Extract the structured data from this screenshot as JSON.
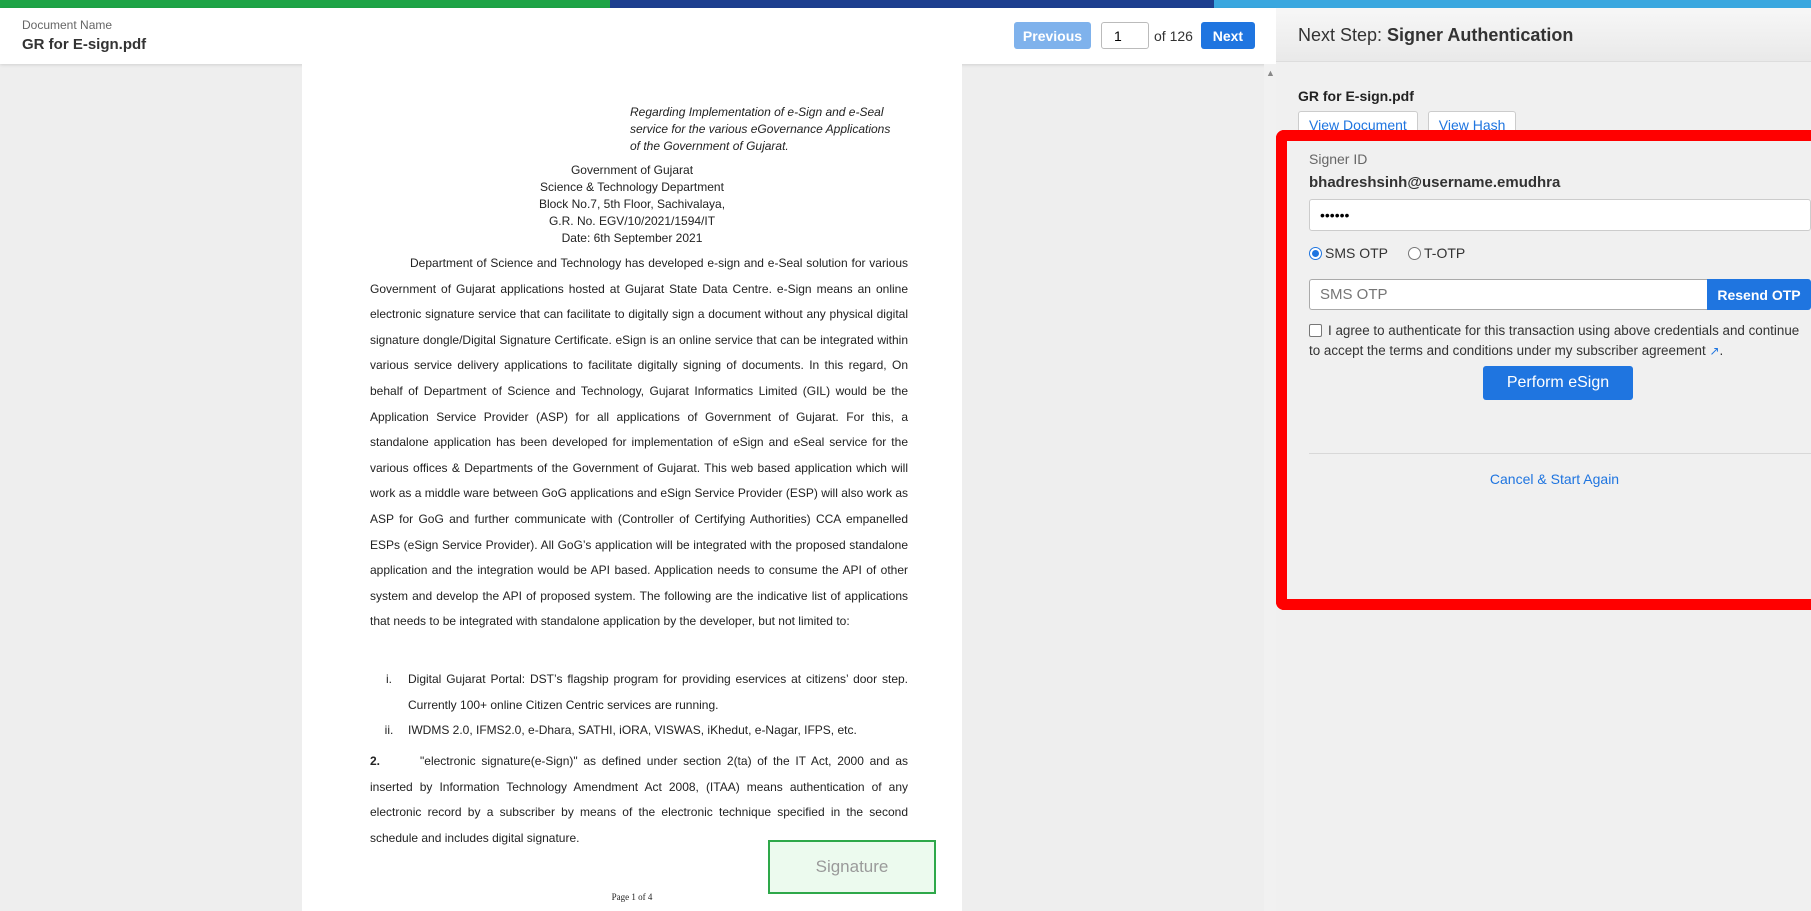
{
  "header": {
    "doc_name_label": "Document Name",
    "doc_name": "GR for E-sign.pdf",
    "previous_label": "Previous",
    "page_current": "1",
    "page_total": "of 126",
    "next_label": "Next"
  },
  "document": {
    "ref_lines": [
      "Regarding Implementation of e-Sign and e-Seal",
      "service for the various eGovernance Applications",
      "of the Government of Gujarat."
    ],
    "center_lines": [
      "Government of Gujarat",
      "Science & Technology Department",
      "Block No.7, 5th Floor, Sachivalaya,",
      "G.R. No. EGV/10/2021/1594/IT",
      "Date: 6th September 2021"
    ],
    "paragraph1": "Department of Science and Technology has developed e-sign and e-Seal solution for various Government of Gujarat applications hosted at Gujarat State Data Centre. e-Sign means an online electronic signature service that can facilitate to digitally sign a document without any physical digital signature dongle/Digital Signature Certificate. eSign is an online service that can be integrated within various service delivery applications to facilitate digitally signing of documents. In this regard, On behalf of Department of Science and Technology, Gujarat Informatics Limited (GIL) would be the Application Service Provider (ASP) for all applications of Government of Gujarat. For this, a standalone application has been developed for implementation of eSign and eSeal service for the various offices & Departments of the Government of Gujarat. This web based application which will work as a middle ware between GoG applications and eSign Service Provider (ESP) will also work as ASP for GoG and further communicate with (Controller of Certifying Authorities) CCA empanelled ESPs (eSign Service Provider). All GoG’s application will be integrated with the proposed standalone application and the integration would be API based. Application needs to consume the API of other system and develop the API of proposed system. The following are the indicative list of applications that needs to be integrated with standalone application by the developer, but not limited to:",
    "list": [
      {
        "num": "i.",
        "text": "Digital Gujarat Portal: DST’s flagship program for providing eservices at citizens’ door step. Currently 100+ online Citizen Centric services are running."
      },
      {
        "num": "ii.",
        "text": "IWDMS 2.0, IFMS2.0, e-Dhara, SATHI, iORA, VISWAS, iKhedut, e-Nagar, IFPS, etc."
      }
    ],
    "para2_num": "2.",
    "para2_text": "\"electronic signature(e-Sign)\" as defined under section 2(ta) of the IT Act, 2000 and as inserted by Information Technology Amendment Act 2008, (ITAA) means authentication of any electronic record by a subscriber by means of the electronic technique specified in the second schedule and includes digital signature.",
    "signature_label": "Signature",
    "page_footer": "Page 1 of 4"
  },
  "panel": {
    "step_prefix": "Next Step: ",
    "step_name": "Signer Authentication",
    "file_title": "GR for E-sign.pdf",
    "view_document": "View Document",
    "view_hash": "View Hash",
    "signer_id_label": "Signer ID",
    "signer_id": "bhadreshsinh@username.emudhra",
    "password_value": "••••••",
    "sms_otp_label": "SMS OTP",
    "totp_label": "T-OTP",
    "otp_placeholder": "SMS OTP",
    "resend_label": "Resend OTP",
    "agree_text": "I agree to authenticate for this transaction using above credentials and continue to accept the terms and conditions under my subscriber agreement",
    "perform_label": "Perform eSign",
    "cancel_label": "Cancel & Start Again",
    "colors": {
      "accent": "#1f75e0",
      "highlight": "#ff0000",
      "signature_border": "#2ea84a"
    }
  }
}
